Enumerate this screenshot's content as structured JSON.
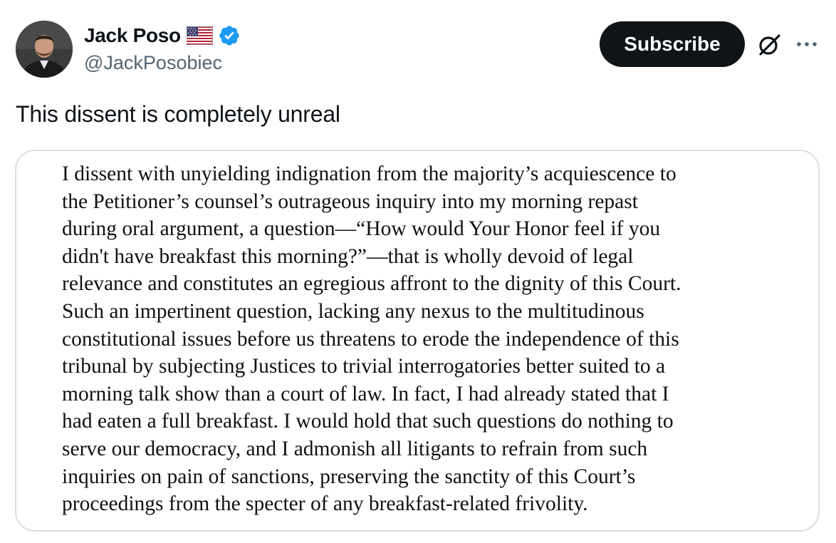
{
  "author": {
    "display_name": "Jack Poso",
    "handle": "@JackPosobiec",
    "flag_icon": "us-flag-icon",
    "verified_icon": "verified-badge-icon",
    "verified_color": "#1d9bf0"
  },
  "actions": {
    "subscribe_label": "Subscribe",
    "grok_icon": "grok-icon",
    "more_icon": "more-icon"
  },
  "tweet": {
    "text": "This dissent is completely unreal"
  },
  "media": {
    "lines": [
      "I dissent with unyielding indignation from the majority’s acquiescence to",
      "the Petitioner’s counsel’s outrageous inquiry into my morning repast",
      "during oral argument, a question—“How would Your Honor feel if you",
      "didn't have breakfast this morning?”—that is wholly devoid of legal",
      "relevance and constitutes an egregious affront to the dignity of this Court.",
      "Such an impertinent question, lacking any nexus to the multitudinous",
      "constitutional issues before us threatens to erode the independence of this",
      "tribunal by subjecting Justices to trivial interrogatories better suited to a",
      "morning talk show than a court of law. In fact, I had already stated that I",
      "had eaten a full breakfast. I would hold that such questions do nothing to",
      "serve our democracy, and I admonish all litigants to refrain from such",
      "inquiries on pain of sanctions, preserving the sanctity of this Court’s",
      "proceedings from the specter of any breakfast-related frivolity."
    ]
  },
  "colors": {
    "text_primary": "#0f1419",
    "text_secondary": "#536471",
    "button_bg": "#0f1419",
    "card_border": "#d8dee3"
  }
}
